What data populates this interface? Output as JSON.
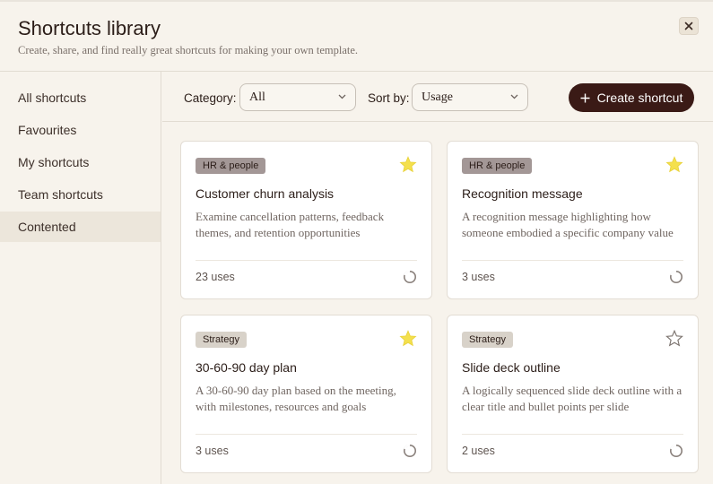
{
  "header": {
    "title": "Shortcuts library",
    "subtitle": "Create, share, and find really great shortcuts for making your own template.",
    "close_icon": "close-icon"
  },
  "sidebar": {
    "items": [
      {
        "label": "All shortcuts",
        "active": false
      },
      {
        "label": "Favourites",
        "active": false
      },
      {
        "label": "My shortcuts",
        "active": false
      },
      {
        "label": "Team shortcuts",
        "active": false
      },
      {
        "label": "Contented",
        "active": true
      }
    ]
  },
  "toolbar": {
    "category_label": "Category:",
    "category_value": "All",
    "sort_label": "Sort by:",
    "sort_value": "Usage",
    "create_label": "Create shortcut",
    "create_icon": "plus-icon"
  },
  "cards": [
    {
      "tag": "HR & people",
      "title": "Customer churn analysis",
      "description": "Examine cancellation patterns, feedback themes, and retention opportunities",
      "uses": "23 uses",
      "favourited": true
    },
    {
      "tag": "HR & people",
      "title": "Recognition message",
      "description": "A recognition message highlighting how someone embodied a specific company value",
      "uses": "3 uses",
      "favourited": true
    },
    {
      "tag": "Strategy",
      "title": "30-60-90 day plan",
      "description": "A 30-60-90 day plan based on the meeting, with milestones, resources and goals",
      "uses": "3 uses",
      "favourited": true
    },
    {
      "tag": "Strategy",
      "title": "Slide deck outline",
      "description": "A logically sequenced slide deck outline with a clear title and bullet points per slide",
      "uses": "2 uses",
      "favourited": false
    }
  ],
  "colors": {
    "background": "#f7f3ec",
    "accent_button": "#3a1a16",
    "star_filled": "#f4e04d",
    "star_outline": "#7d7570",
    "tag_hr": "#a39796",
    "tag_strategy": "#d8d2c9"
  }
}
